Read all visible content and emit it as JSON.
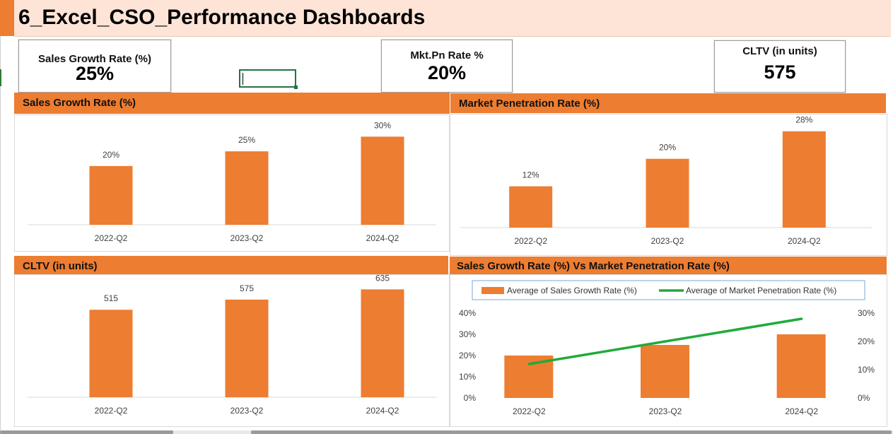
{
  "title": "6_Excel_CSO_Performance Dashboards",
  "kpis": {
    "sales_growth": {
      "label": "Sales Growth Rate (%)",
      "value": "25%"
    },
    "mkt_pn": {
      "label": "Mkt.Pn Rate %",
      "value": "20%"
    },
    "cltv": {
      "label": "CLTV (in units)",
      "value": "575"
    }
  },
  "colors": {
    "accent": "#ed7d31",
    "header_bg": "#fde4d7",
    "line": "#1fab3a",
    "selection": "#217346"
  },
  "chart_data": [
    {
      "type": "bar",
      "title": "Sales Growth Rate (%)",
      "categories": [
        "2022-Q2",
        "2023-Q2",
        "2024-Q2"
      ],
      "values": [
        20,
        25,
        30
      ],
      "labels": [
        "20%",
        "25%",
        "30%"
      ],
      "ylim": [
        0,
        32
      ],
      "grid": false
    },
    {
      "type": "bar",
      "title": "Market Penetration Rate (%)",
      "categories": [
        "2022-Q2",
        "2023-Q2",
        "2024-Q2"
      ],
      "values": [
        12,
        20,
        28
      ],
      "labels": [
        "12%",
        "20%",
        "28%"
      ],
      "ylim": [
        0,
        30
      ],
      "grid": false
    },
    {
      "type": "bar",
      "title": "CLTV (in units)",
      "categories": [
        "2022-Q2",
        "2023-Q2",
        "2024-Q2"
      ],
      "values": [
        515,
        575,
        635
      ],
      "labels": [
        "515",
        "575",
        "635"
      ],
      "ylim": [
        0,
        670
      ],
      "grid": false
    },
    {
      "type": "bar",
      "title": "Sales Growth Rate (%) Vs Market Penetration Rate (%)",
      "categories": [
        "2022-Q2",
        "2023-Q2",
        "2024-Q2"
      ],
      "legend_position": "top",
      "series": [
        {
          "name": "Average of Sales Growth Rate (%)",
          "type": "bar",
          "axis": "left",
          "values": [
            20,
            25,
            30
          ]
        },
        {
          "name": "Average of Market Penetration Rate (%)",
          "type": "line",
          "axis": "right",
          "values": [
            12,
            20,
            28
          ]
        }
      ],
      "y_left": {
        "ylim": [
          0,
          40
        ],
        "ticks": [
          "0%",
          "10%",
          "20%",
          "30%",
          "40%"
        ]
      },
      "y_right": {
        "ylim": [
          0,
          30
        ],
        "ticks": [
          "0%",
          "10%",
          "20%",
          "30%"
        ]
      },
      "grid": false
    }
  ]
}
